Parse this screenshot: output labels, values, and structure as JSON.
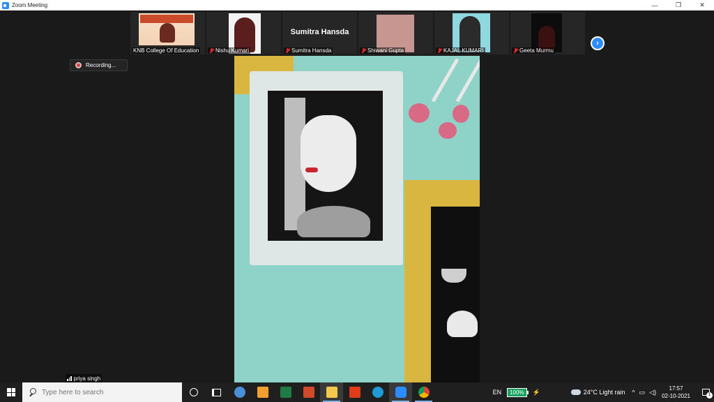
{
  "window": {
    "title": "Zoom Meeting",
    "controls": {
      "minimize": "—",
      "restore": "❐",
      "close": "✕"
    }
  },
  "thumbnails": [
    {
      "name": "KNB College Of Education",
      "muted": false
    },
    {
      "name": "Nishu Kumari",
      "muted": true
    },
    {
      "name": "Sumitra Hansda",
      "muted": true,
      "big_name": "Sumitra Hansda"
    },
    {
      "name": "Shiwani Gupta",
      "muted": true
    },
    {
      "name": "KAJAL KUMARI",
      "muted": true
    },
    {
      "name": "Geeta Murmu",
      "muted": true
    }
  ],
  "next_arrow": "›",
  "recording": {
    "label": "Recording..."
  },
  "active_speaker": {
    "name": "priya singh"
  },
  "taskbar": {
    "search_placeholder": "Type here to search",
    "apps": [
      "cortana-icon",
      "task-view-icon",
      "browser-icon",
      "store-icon",
      "excel-icon",
      "powerpoint-icon",
      "file-explorer-icon",
      "office-icon",
      "edge-icon",
      "zoom-icon",
      "chrome-icon"
    ],
    "tray": {
      "language": "EN",
      "battery": "100%",
      "weather": "24°C  Light rain",
      "time": "17:57",
      "date": "02-10-2021",
      "notification_count": "1"
    }
  },
  "colors": {
    "zoom_blue": "#2d8cff",
    "muted_red": "#e02828",
    "battery_green": "#1aa260"
  }
}
